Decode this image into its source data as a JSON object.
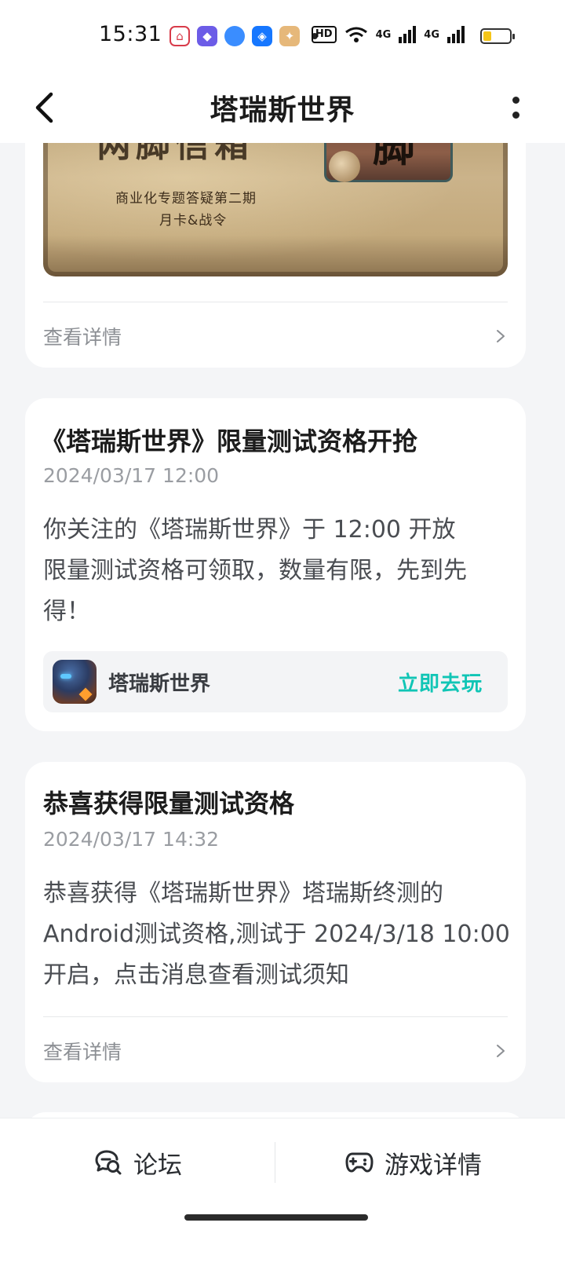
{
  "status_bar": {
    "time": "15:31",
    "hd_label": "HD",
    "network_1": "4G",
    "network_2": "4G",
    "battery_level": 0.3
  },
  "header": {
    "title": "塔瑞斯世界"
  },
  "cards": [
    {
      "banner": {
        "big_text": "两脚信箱",
        "line1": "商业化专题答疑第二期",
        "line2": "月卡&战令",
        "portrait_char": "脚"
      },
      "detail_label": "查看详情"
    },
    {
      "title": "《塔瑞斯世界》限量测试资格开抢",
      "date": "2024/03/17 12:00",
      "body_lines": [
        "你关注的《塔瑞斯世界》于 12:00 开放",
        "限量测试资格可领取，数量有限，先到先",
        "得！"
      ],
      "game": {
        "name": "塔瑞斯世界",
        "action": "立即去玩"
      }
    },
    {
      "title": "恭喜获得限量测试资格",
      "date": "2024/03/17 14:32",
      "body_lines": [
        "恭喜获得《塔瑞斯世界》塔瑞斯终测的",
        "Android测试资格,测试于 2024/3/18 10:00",
        "开启，点击消息查看测试须知"
      ],
      "detail_label": "查看详情"
    }
  ],
  "bottom_nav": {
    "forum": "论坛",
    "game_details": "游戏详情"
  }
}
